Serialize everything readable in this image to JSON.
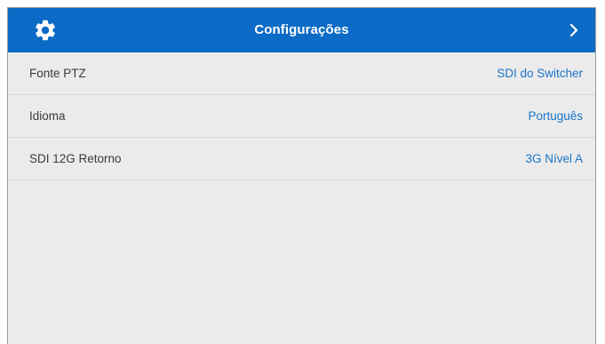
{
  "header": {
    "title": "Configurações",
    "left_icon": "gear-icon",
    "right_icon": "chevron-right-icon",
    "background_color": "#0c6bc6"
  },
  "settings": [
    {
      "label": "Fonte PTZ",
      "value": "SDI do Switcher"
    },
    {
      "label": "Idioma",
      "value": "Português"
    },
    {
      "label": "SDI 12G Retorno",
      "value": "3G Nível A"
    }
  ],
  "colors": {
    "value_text": "#1a74c8",
    "panel_background": "#ebebeb"
  }
}
